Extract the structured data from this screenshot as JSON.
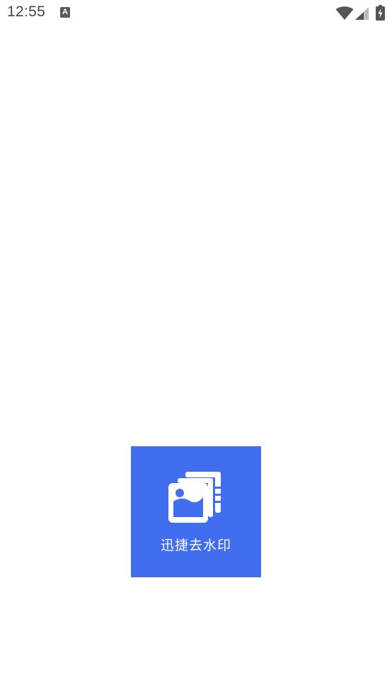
{
  "status_bar": {
    "time": "12:55",
    "notification_icon": "text-input-method-icon",
    "notification_glyph": "A",
    "wifi_icon": "wifi-icon",
    "signal_icon": "cell-signal-icon",
    "battery_icon": "battery-charging-icon"
  },
  "splash": {
    "app_name": "迅捷去水印",
    "logo_icon": "image-stack-icon",
    "background_color": "#416def",
    "icon_color": "#ffffff"
  }
}
